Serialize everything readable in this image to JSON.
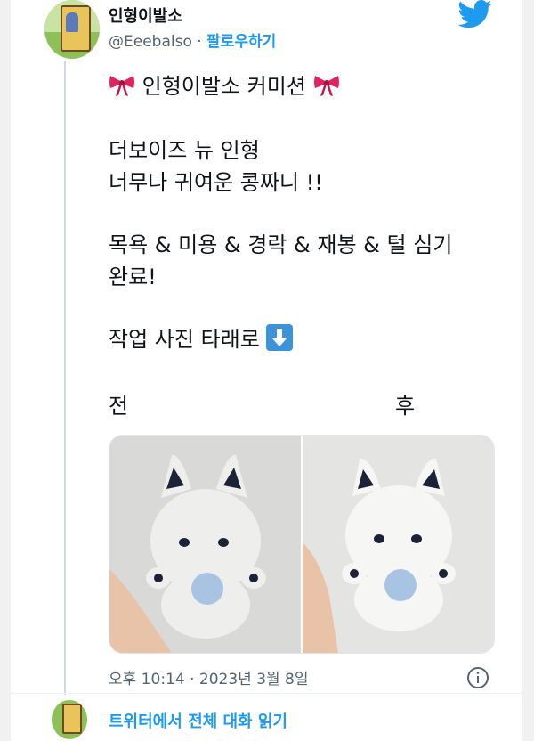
{
  "author": {
    "display_name": "인형이발소",
    "handle": "@Eeebalso",
    "separator": "·",
    "follow_label": "팔로우하기"
  },
  "tweet": {
    "title": "인형이발소 커미션",
    "line2": "더보이즈 뉴 인형",
    "line3": "너무나 귀여운 콩짜니 !!",
    "line4": "목욕 & 미용 & 경락 & 재봉 & 털 심기",
    "line5": "완료!",
    "line6": "작업 사진 타래로",
    "label_before": "전",
    "label_after": "후"
  },
  "meta": {
    "time": "오후 10:14 · 2023년 3월 8일"
  },
  "footer": {
    "read_thread": "트위터에서 전체 대화 읽기"
  },
  "colors": {
    "accent": "#1d9bf0",
    "muted_text": "#536471",
    "text": "#0f1419",
    "ribbon": "#e0245e"
  },
  "icons": [
    "twitter-bird-icon",
    "ribbon-emoji",
    "down-arrow-emoji",
    "info-icon"
  ]
}
